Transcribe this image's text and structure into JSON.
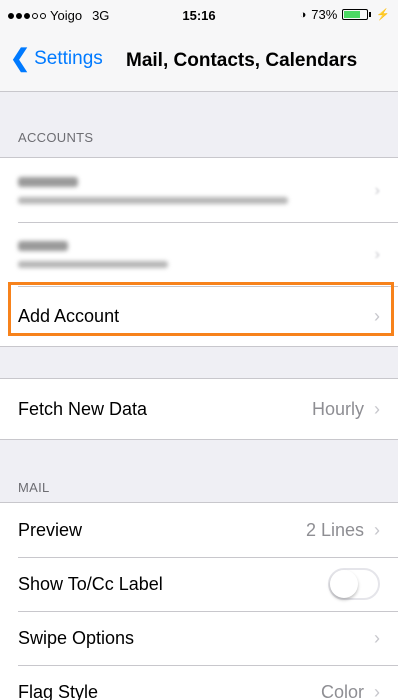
{
  "status_bar": {
    "carrier": "Yoigo",
    "network": "3G",
    "time": "15:16",
    "battery_percent": "73%",
    "battery_level": 0.73
  },
  "nav": {
    "back_label": "Settings",
    "title": "Mail, Contacts, Calendars"
  },
  "accounts": {
    "header": "ACCOUNTS",
    "add_account_label": "Add Account"
  },
  "fetch": {
    "label": "Fetch New Data",
    "value": "Hourly"
  },
  "mail": {
    "header": "MAIL",
    "rows": {
      "preview": {
        "label": "Preview",
        "value": "2 Lines"
      },
      "show_to_cc": {
        "label": "Show To/Cc Label",
        "enabled": false
      },
      "swipe_options": {
        "label": "Swipe Options"
      },
      "flag_style": {
        "label": "Flag Style",
        "value": "Color"
      }
    }
  },
  "colors": {
    "accent": "#007aff",
    "highlight": "#f7821b",
    "battery": "#4cd964"
  }
}
